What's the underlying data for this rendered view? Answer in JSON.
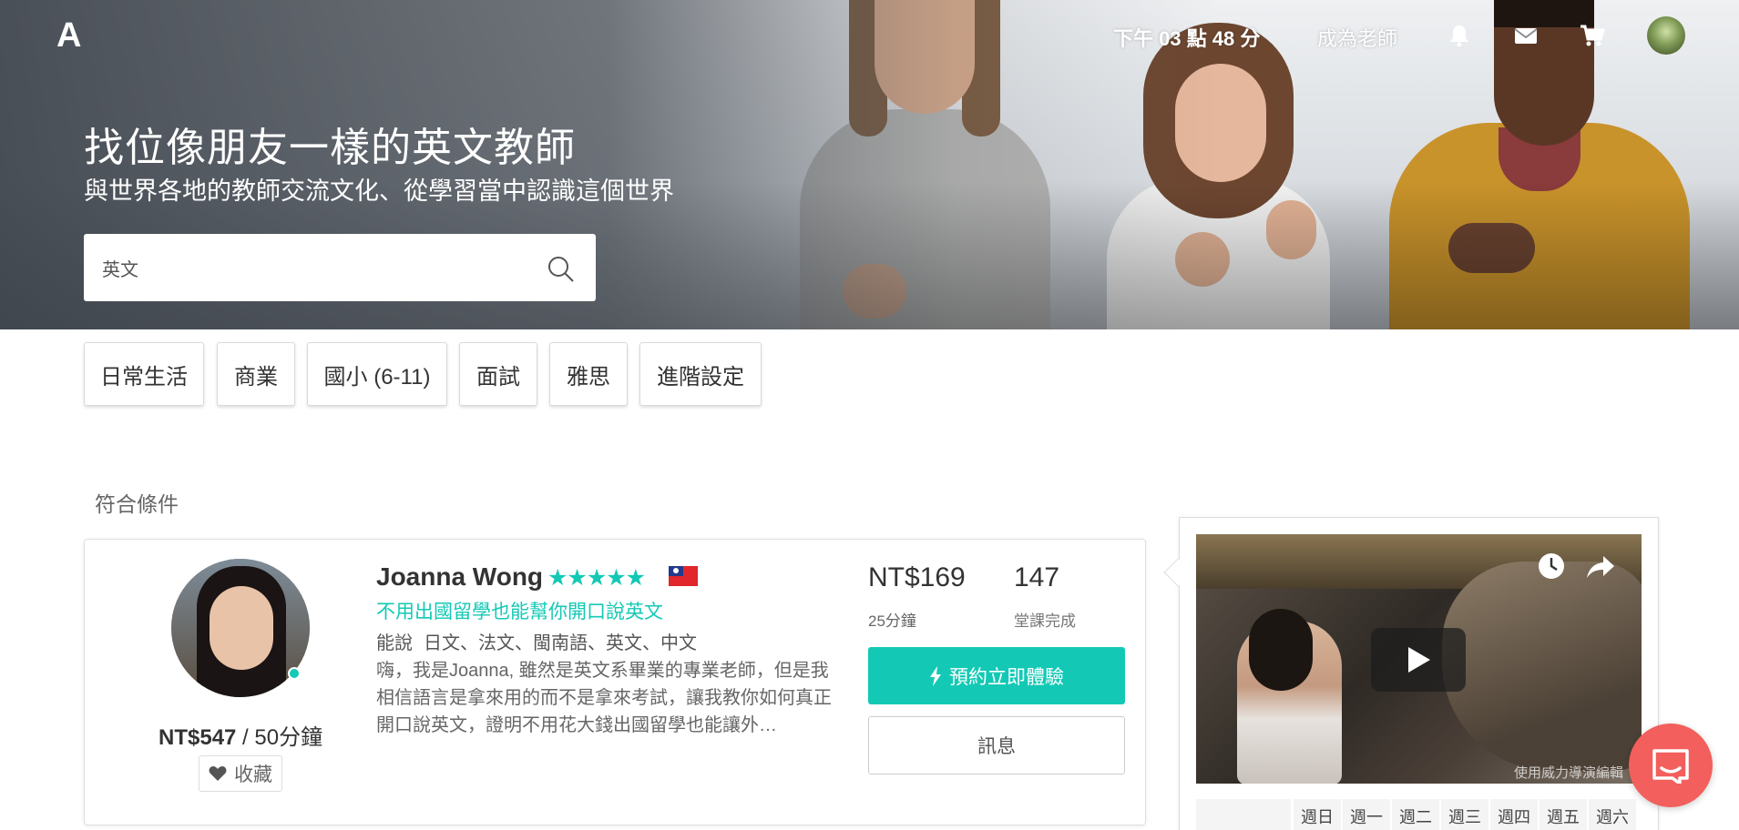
{
  "header": {
    "logo": "A",
    "time": "下午 03 點 48 分",
    "become_teacher": "成為老師"
  },
  "hero": {
    "title": "找位像朋友一樣的英文教師",
    "subtitle": "與世界各地的教師交流文化、從學習當中認識這個世界"
  },
  "search": {
    "value": "英文"
  },
  "filters": [
    "日常生活",
    "商業",
    "國小 (6-11)",
    "面試",
    "雅思",
    "進階設定"
  ],
  "results": {
    "label": "符合條件"
  },
  "teacher": {
    "name": "Joanna Wong",
    "stars": "★★★★★",
    "tagline": "不用出國留學也能幫你開口說英文",
    "speaks_label": "能說",
    "languages": "日文、法文、閩南語、英文、中文",
    "description": "嗨，我是Joanna, 雖然是英文系畢業的專業老師，但是我相信語言是拿來用的而不是拿來考試，讓我教你如何真正開口說英文，證明不用花大錢出國留學也能讓外…",
    "trial_price": "NT$169",
    "trial_duration": "25分鐘",
    "lessons_count": "147",
    "lessons_label": "堂課完成",
    "book_label": "預約立即體驗",
    "message_label": "訊息",
    "regular_price": "NT$547",
    "regular_duration": " / 50分鐘",
    "favorite_label": "收藏"
  },
  "video": {
    "watermark": "使用威力導演編輯"
  },
  "schedule": {
    "days": [
      "週日",
      "週一",
      "週二",
      "週三",
      "週四",
      "週五",
      "週六"
    ]
  },
  "colors": {
    "accent": "#13c9b5",
    "chat": "#f25f5c",
    "flag_red": "#e1262c",
    "flag_blue": "#223a8c"
  }
}
